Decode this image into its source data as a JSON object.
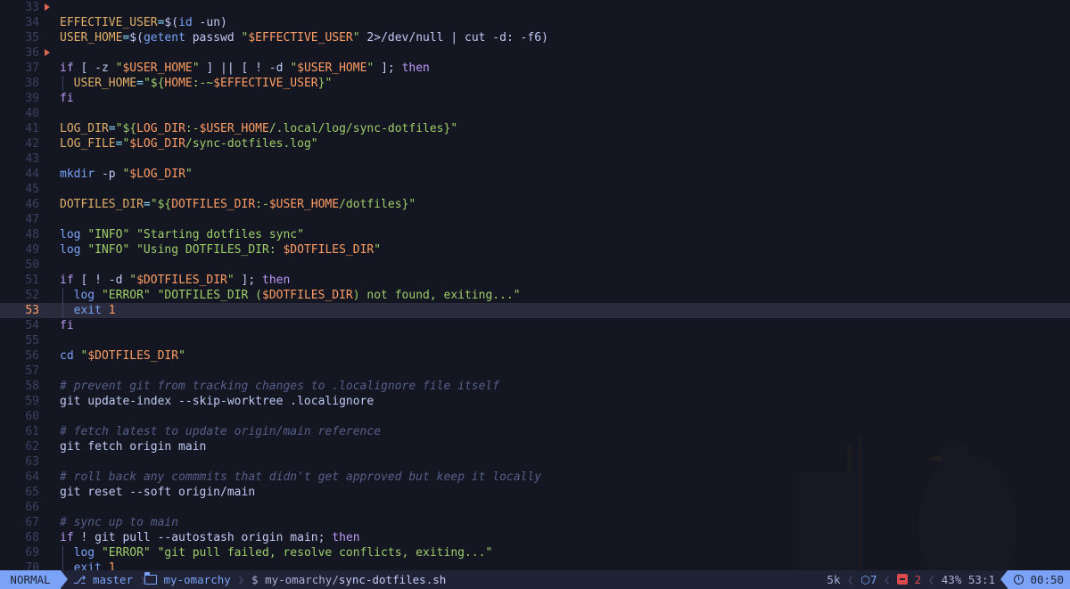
{
  "editor": {
    "current_line": 53,
    "lines": [
      {
        "n": "33",
        "sign": true,
        "guide": false,
        "toks": []
      },
      {
        "n": "34",
        "sign": false,
        "guide": false,
        "toks": [
          [
            "var",
            "EFFECTIVE_USER"
          ],
          [
            "op",
            "="
          ],
          [
            "plain",
            "$("
          ],
          [
            "id",
            "id"
          ],
          [
            "plain",
            " -un)"
          ]
        ]
      },
      {
        "n": "35",
        "sign": false,
        "guide": false,
        "toks": [
          [
            "var",
            "USER_HOME"
          ],
          [
            "op",
            "="
          ],
          [
            "plain",
            "$("
          ],
          [
            "id",
            "getent"
          ],
          [
            "plain",
            " passwd "
          ],
          [
            "str",
            "\""
          ],
          [
            "exp",
            "$EFFECTIVE_USER"
          ],
          [
            "str",
            "\""
          ],
          [
            "plain",
            " 2>/dev/null | cut -d: -f6)"
          ]
        ]
      },
      {
        "n": "36",
        "sign": true,
        "guide": false,
        "toks": []
      },
      {
        "n": "37",
        "sign": false,
        "guide": false,
        "toks": [
          [
            "kw",
            "if"
          ],
          [
            "plain",
            " [ -z "
          ],
          [
            "str",
            "\""
          ],
          [
            "exp",
            "$USER_HOME"
          ],
          [
            "str",
            "\""
          ],
          [
            "plain",
            " ] || [ ! -d "
          ],
          [
            "str",
            "\""
          ],
          [
            "exp",
            "$USER_HOME"
          ],
          [
            "str",
            "\""
          ],
          [
            "plain",
            " ]; "
          ],
          [
            "kw",
            "then"
          ]
        ]
      },
      {
        "n": "38",
        "sign": false,
        "guide": true,
        "toks": [
          [
            "plain",
            "  "
          ],
          [
            "var",
            "USER_HOME"
          ],
          [
            "op",
            "="
          ],
          [
            "str",
            "\"${"
          ],
          [
            "exp",
            "HOME"
          ],
          [
            "str",
            ":-~"
          ],
          [
            "exp",
            "$EFFECTIVE_USER"
          ],
          [
            "str",
            "}\""
          ]
        ]
      },
      {
        "n": "39",
        "sign": false,
        "guide": false,
        "toks": [
          [
            "kw",
            "fi"
          ]
        ]
      },
      {
        "n": "40",
        "sign": false,
        "guide": false,
        "toks": []
      },
      {
        "n": "41",
        "sign": false,
        "guide": false,
        "toks": [
          [
            "var",
            "LOG_DIR"
          ],
          [
            "op",
            "="
          ],
          [
            "str",
            "\"${"
          ],
          [
            "exp",
            "LOG_DIR"
          ],
          [
            "str",
            ":-"
          ],
          [
            "exp",
            "$USER_HOME"
          ],
          [
            "str",
            "/.local/log/sync-dotfiles}\""
          ]
        ]
      },
      {
        "n": "42",
        "sign": false,
        "guide": false,
        "toks": [
          [
            "var",
            "LOG_FILE"
          ],
          [
            "op",
            "="
          ],
          [
            "str",
            "\""
          ],
          [
            "exp",
            "$LOG_DIR"
          ],
          [
            "str",
            "/sync-dotfiles.log\""
          ]
        ]
      },
      {
        "n": "43",
        "sign": false,
        "guide": false,
        "toks": []
      },
      {
        "n": "44",
        "sign": false,
        "guide": false,
        "toks": [
          [
            "id",
            "mkdir"
          ],
          [
            "plain",
            " -p "
          ],
          [
            "str",
            "\""
          ],
          [
            "exp",
            "$LOG_DIR"
          ],
          [
            "str",
            "\""
          ]
        ]
      },
      {
        "n": "45",
        "sign": false,
        "guide": false,
        "toks": []
      },
      {
        "n": "46",
        "sign": false,
        "guide": false,
        "toks": [
          [
            "var",
            "DOTFILES_DIR"
          ],
          [
            "op",
            "="
          ],
          [
            "str",
            "\"${"
          ],
          [
            "exp",
            "DOTFILES_DIR"
          ],
          [
            "str",
            ":-"
          ],
          [
            "exp",
            "$USER_HOME"
          ],
          [
            "str",
            "/dotfiles}\""
          ]
        ]
      },
      {
        "n": "47",
        "sign": false,
        "guide": false,
        "toks": []
      },
      {
        "n": "48",
        "sign": false,
        "guide": false,
        "toks": [
          [
            "id",
            "log"
          ],
          [
            "plain",
            " "
          ],
          [
            "str",
            "\"INFO\""
          ],
          [
            "plain",
            " "
          ],
          [
            "str",
            "\"Starting dotfiles sync\""
          ]
        ]
      },
      {
        "n": "49",
        "sign": false,
        "guide": false,
        "toks": [
          [
            "id",
            "log"
          ],
          [
            "plain",
            " "
          ],
          [
            "str",
            "\"INFO\""
          ],
          [
            "plain",
            " "
          ],
          [
            "str",
            "\"Using DOTFILES_DIR: "
          ],
          [
            "exp",
            "$DOTFILES_DIR"
          ],
          [
            "str",
            "\""
          ]
        ]
      },
      {
        "n": "50",
        "sign": false,
        "guide": false,
        "toks": []
      },
      {
        "n": "51",
        "sign": false,
        "guide": false,
        "toks": [
          [
            "kw",
            "if"
          ],
          [
            "plain",
            " [ ! -d "
          ],
          [
            "str",
            "\""
          ],
          [
            "exp",
            "$DOTFILES_DIR"
          ],
          [
            "str",
            "\""
          ],
          [
            "plain",
            " ]; "
          ],
          [
            "kw",
            "then"
          ]
        ]
      },
      {
        "n": "52",
        "sign": false,
        "guide": true,
        "toks": [
          [
            "plain",
            "  "
          ],
          [
            "id",
            "log"
          ],
          [
            "plain",
            " "
          ],
          [
            "str",
            "\"ERROR\""
          ],
          [
            "plain",
            " "
          ],
          [
            "str",
            "\"DOTFILES_DIR ("
          ],
          [
            "exp",
            "$DOTFILES_DIR"
          ],
          [
            "str",
            ") not found, exiting...\""
          ]
        ]
      },
      {
        "n": "53",
        "sign": false,
        "guide": true,
        "toks": [
          [
            "plain",
            "  "
          ],
          [
            "id",
            "exit"
          ],
          [
            "plain",
            " "
          ],
          [
            "num",
            "1"
          ]
        ]
      },
      {
        "n": "54",
        "sign": false,
        "guide": false,
        "toks": [
          [
            "kw",
            "fi"
          ]
        ]
      },
      {
        "n": "55",
        "sign": false,
        "guide": false,
        "toks": []
      },
      {
        "n": "56",
        "sign": false,
        "guide": false,
        "toks": [
          [
            "id",
            "cd"
          ],
          [
            "plain",
            " "
          ],
          [
            "str",
            "\""
          ],
          [
            "exp",
            "$DOTFILES_DIR"
          ],
          [
            "str",
            "\""
          ]
        ]
      },
      {
        "n": "57",
        "sign": false,
        "guide": false,
        "toks": []
      },
      {
        "n": "58",
        "sign": false,
        "guide": false,
        "toks": [
          [
            "com",
            "# prevent git from tracking changes to .localignore file itself"
          ]
        ]
      },
      {
        "n": "59",
        "sign": false,
        "guide": false,
        "toks": [
          [
            "cmd",
            "git update-index --skip-worktree .localignore"
          ]
        ]
      },
      {
        "n": "60",
        "sign": false,
        "guide": false,
        "toks": []
      },
      {
        "n": "61",
        "sign": false,
        "guide": false,
        "toks": [
          [
            "com",
            "# fetch latest to update origin/main reference"
          ]
        ]
      },
      {
        "n": "62",
        "sign": false,
        "guide": false,
        "toks": [
          [
            "cmd",
            "git fetch origin main"
          ]
        ]
      },
      {
        "n": "63",
        "sign": false,
        "guide": false,
        "toks": []
      },
      {
        "n": "64",
        "sign": false,
        "guide": false,
        "toks": [
          [
            "com",
            "# roll back any commmits that didn't get approved but keep it locally"
          ]
        ]
      },
      {
        "n": "65",
        "sign": false,
        "guide": false,
        "toks": [
          [
            "cmd",
            "git reset --soft origin/main"
          ]
        ]
      },
      {
        "n": "66",
        "sign": false,
        "guide": false,
        "toks": []
      },
      {
        "n": "67",
        "sign": false,
        "guide": false,
        "toks": [
          [
            "com",
            "# sync up to main"
          ]
        ]
      },
      {
        "n": "68",
        "sign": false,
        "guide": false,
        "toks": [
          [
            "kw",
            "if"
          ],
          [
            "plain",
            " ! "
          ],
          [
            "cmd",
            "git pull --autostash origin main"
          ],
          [
            "plain",
            "; "
          ],
          [
            "kw",
            "then"
          ]
        ]
      },
      {
        "n": "69",
        "sign": false,
        "guide": true,
        "toks": [
          [
            "plain",
            "  "
          ],
          [
            "id",
            "log"
          ],
          [
            "plain",
            " "
          ],
          [
            "str",
            "\"ERROR\""
          ],
          [
            "plain",
            " "
          ],
          [
            "str",
            "\"git pull failed, resolve conflicts, exiting...\""
          ]
        ]
      },
      {
        "n": "70",
        "sign": false,
        "guide": true,
        "toks": [
          [
            "plain",
            "  "
          ],
          [
            "id",
            "exit"
          ],
          [
            "plain",
            " "
          ],
          [
            "num",
            "1"
          ]
        ]
      }
    ]
  },
  "statusline": {
    "mode": "NORMAL",
    "branch_icon": "git-branch-icon",
    "branch": "master",
    "dir_icon": "folder-icon",
    "dir": "my-omarchy",
    "prompt": "$",
    "path_dir": "my-omarchy/",
    "path_file": "sync-dotfiles.sh",
    "size": "5k",
    "lsp_icon": "cube-icon",
    "lsp_count": "7",
    "error_icon": "error-icon",
    "error_count": "2",
    "percent": "43%",
    "position": "53:1",
    "clock_icon": "clock-icon",
    "time": "00:50"
  },
  "colors": {
    "accent": "#7aa2f7",
    "background": "#141621",
    "statusline_bg": "#1f2335",
    "error": "#db4b4b"
  }
}
